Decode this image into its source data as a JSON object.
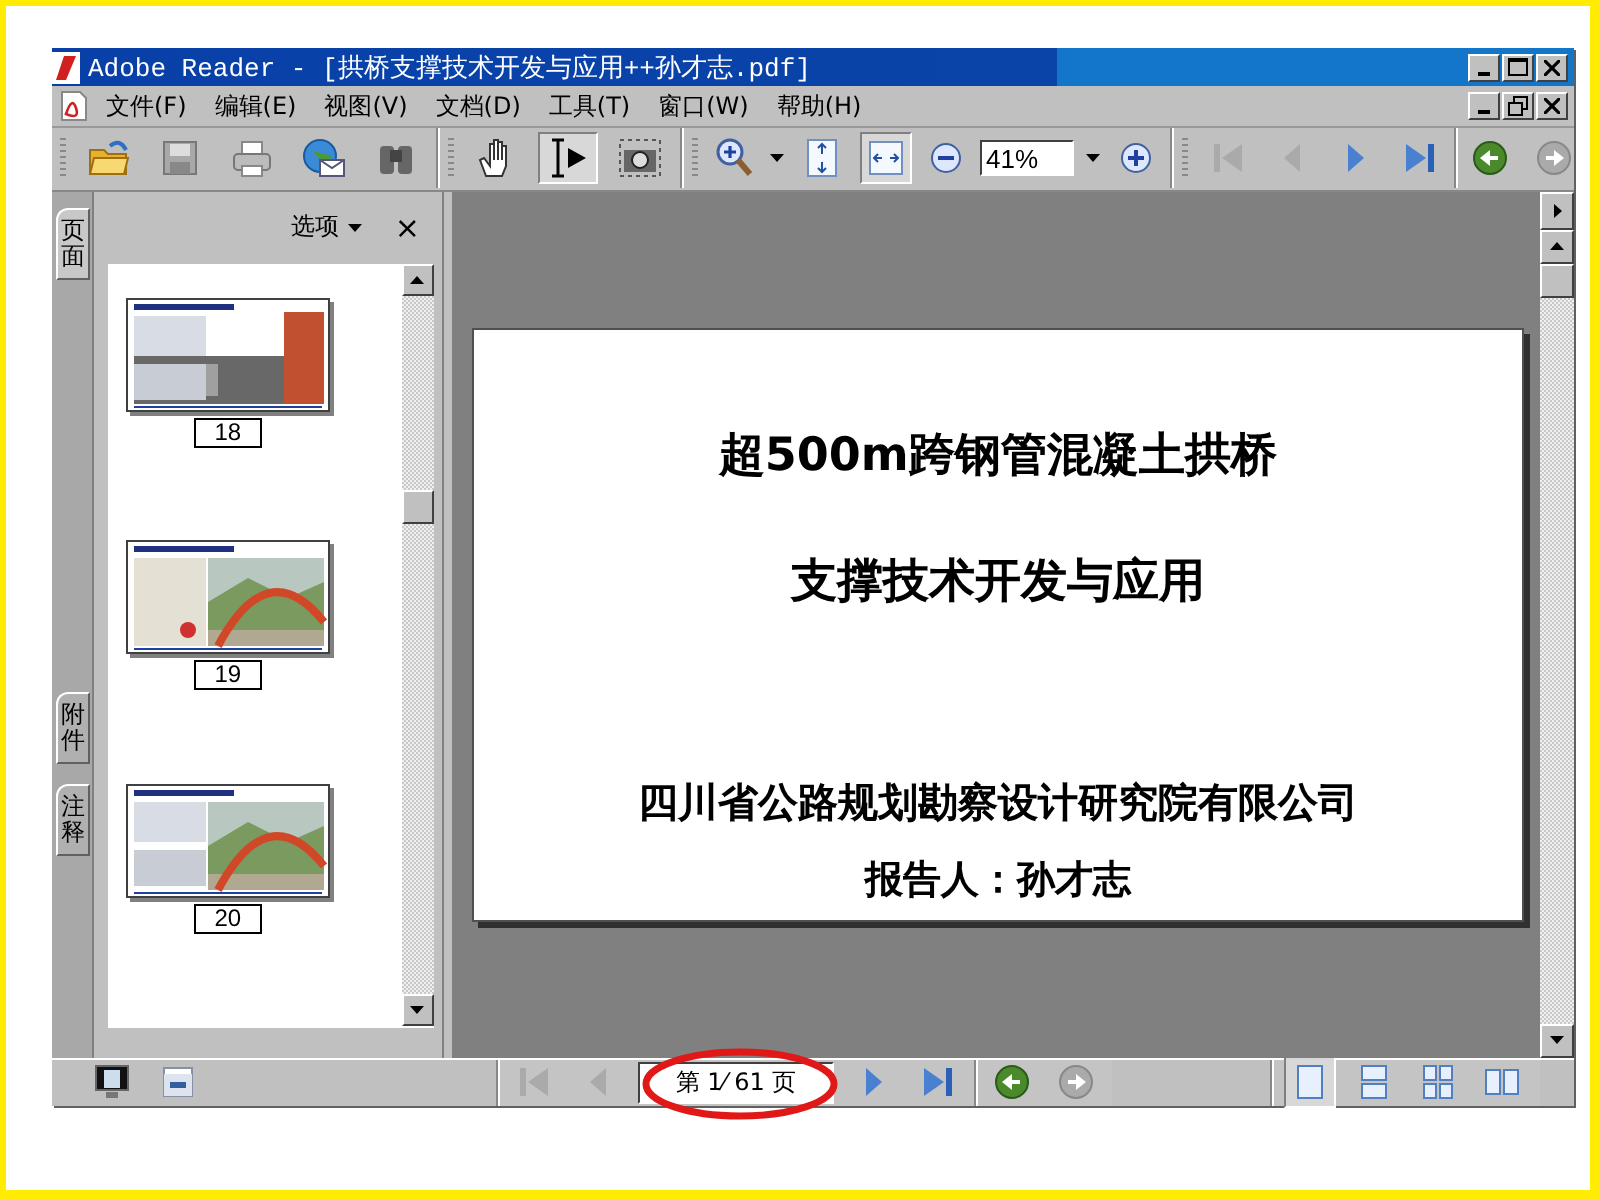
{
  "window": {
    "title": "Adobe Reader - [拱桥支撑技术开发与应用++孙才志.pdf]"
  },
  "menu": [
    {
      "label": "文件(F)"
    },
    {
      "label": "编辑(E)"
    },
    {
      "label": "视图(V)"
    },
    {
      "label": "文档(D)"
    },
    {
      "label": "工具(T)"
    },
    {
      "label": "窗口(W)"
    },
    {
      "label": "帮助(H)"
    }
  ],
  "toolbar": {
    "tools": [
      {
        "kind": "hand",
        "pressed": false
      },
      {
        "kind": "select",
        "pressed": true
      },
      {
        "kind": "snapshot",
        "pressed": false
      }
    ],
    "fit_width_pressed": true,
    "zoom": "41%"
  },
  "side_tabs": [
    {
      "label": "页面",
      "selected": true
    },
    {
      "label": "附件",
      "selected": false
    },
    {
      "label": "注释",
      "selected": false
    }
  ],
  "panel": {
    "options": "选项",
    "close": "×",
    "thumbnails": [
      {
        "page": "18",
        "kind": "picture"
      },
      {
        "page": "19",
        "kind": "picture"
      },
      {
        "page": "20",
        "kind": "picture"
      }
    ]
  },
  "slide": {
    "title_lines": [
      "超500m跨钢管混凝土拱桥",
      "支撑技术开发与应用"
    ],
    "organization": "四川省公路规划勘察设计研究院有限公司",
    "presenter": "报告人：孙才志"
  },
  "status": {
    "page_field": "第 1⁄ 61 页",
    "views": [
      {
        "kind": "single",
        "selected": true
      },
      {
        "kind": "continuous",
        "selected": false
      },
      {
        "kind": "continuous-facing",
        "selected": false
      },
      {
        "kind": "facing",
        "selected": false
      }
    ]
  }
}
